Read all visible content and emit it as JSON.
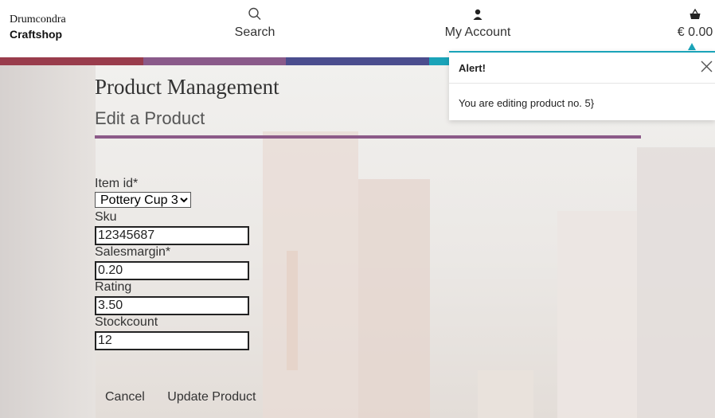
{
  "header": {
    "brand_line1": "Drumcondra",
    "brand_line2": "Craftshop",
    "nav": {
      "search_label": "Search",
      "account_label": "My Account",
      "cart_total": "€ 0.00"
    }
  },
  "stripe_colors": [
    "#993c4c",
    "#8a5a8a",
    "#4b4d8e",
    "#1aa3b8",
    "#ffffff"
  ],
  "page": {
    "title": "Product Management",
    "subtitle": "Edit a Product"
  },
  "form": {
    "item_id_label": "Item id*",
    "item_id_selected": "Pottery Cup 3",
    "sku_label": "Sku",
    "sku_value": "12345687",
    "salesmargin_label": "Salesmargin*",
    "salesmargin_value": "0.20",
    "rating_label": "Rating",
    "rating_value": "3.50",
    "stockcount_label": "Stockcount",
    "stockcount_value": "12",
    "cancel_label": "Cancel",
    "update_label": "Update Product"
  },
  "alert": {
    "title": "Alert!",
    "message": "You are editing product no. 5}"
  },
  "icons": {
    "search": "search-icon",
    "account": "user-icon",
    "cart": "basket-icon",
    "close": "close-icon"
  }
}
